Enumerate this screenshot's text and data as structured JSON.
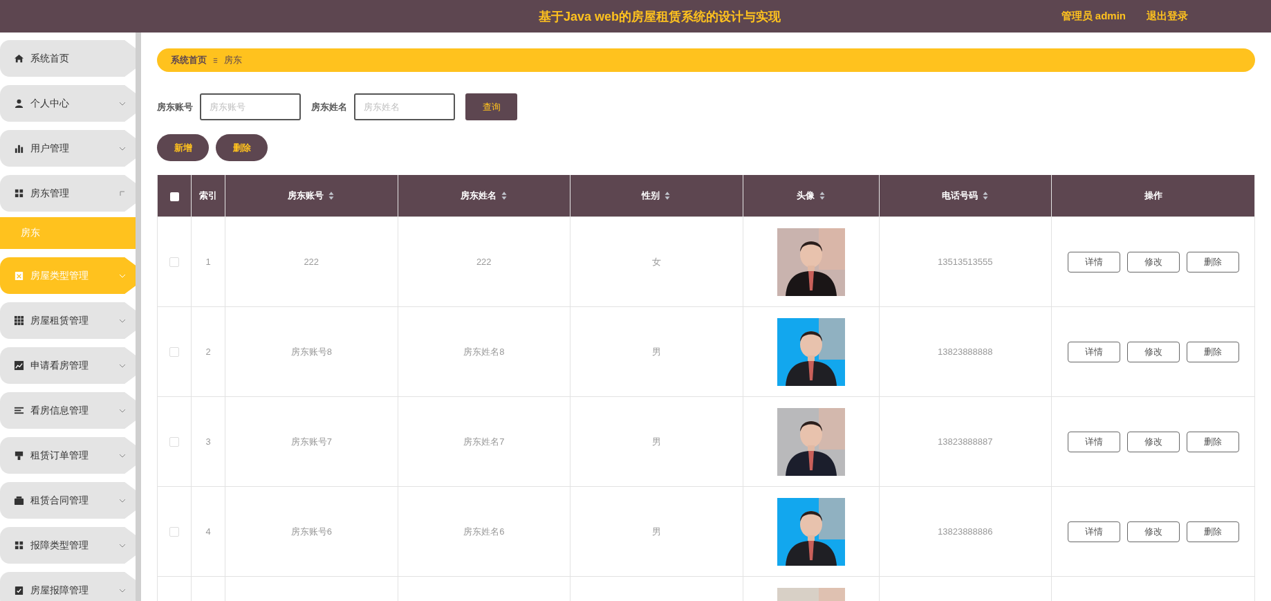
{
  "header": {
    "title": "基于Java web的房屋租赁系统的设计与实现",
    "user": "管理员 admin",
    "logout": "退出登录"
  },
  "sidebar": {
    "items": [
      {
        "label": "系统首页",
        "selected": false
      },
      {
        "label": "个人中心",
        "selected": false,
        "expanded": false
      },
      {
        "label": "用户管理",
        "selected": false,
        "expanded": false
      },
      {
        "label": "房东管理",
        "selected": false,
        "expanded": true,
        "children": [
          {
            "label": "房东",
            "selected": true
          }
        ]
      },
      {
        "label": "房屋类型管理",
        "selected": true,
        "expanded": false
      },
      {
        "label": "房屋租赁管理",
        "selected": false,
        "expanded": false
      },
      {
        "label": "申请看房管理",
        "selected": false,
        "expanded": false
      },
      {
        "label": "看房信息管理",
        "selected": false,
        "expanded": false
      },
      {
        "label": "租赁订单管理",
        "selected": false,
        "expanded": false
      },
      {
        "label": "租赁合同管理",
        "selected": false,
        "expanded": false
      },
      {
        "label": "报障类型管理",
        "selected": false,
        "expanded": false
      },
      {
        "label": "房屋报障管理",
        "selected": false,
        "expanded": false
      }
    ]
  },
  "breadcrumb": [
    "系统首页",
    "房东"
  ],
  "search": {
    "fields": [
      {
        "label": "房东账号",
        "placeholder": "房东账号"
      },
      {
        "label": "房东姓名",
        "placeholder": "房东姓名"
      }
    ],
    "button": "查询"
  },
  "actions": [
    "新增",
    "删除"
  ],
  "table": {
    "select_all": {
      "checked": false
    },
    "columns": [
      {
        "label": "索引",
        "sortable": false
      },
      {
        "label": "房东账号",
        "sortable": true
      },
      {
        "label": "房东姓名",
        "sortable": true
      },
      {
        "label": "性别",
        "sortable": true
      },
      {
        "label": "头像",
        "sortable": true
      },
      {
        "label": "电话号码",
        "sortable": true
      },
      {
        "label": "操作",
        "sortable": false
      }
    ],
    "rows": [
      {
        "checked": false,
        "index": "1",
        "account": "222",
        "name": "222",
        "gender": "女",
        "avatar": {
          "kind": "picture"
        },
        "phone": "13513513555",
        "actions": [
          "详情",
          "修改",
          "删除"
        ]
      },
      {
        "checked": false,
        "index": "2",
        "account": "房东账号8",
        "name": "房东姓名8",
        "gender": "男",
        "avatar": {
          "kind": "picture"
        },
        "phone": "13823888888",
        "actions": [
          "详情",
          "修改",
          "删除"
        ]
      },
      {
        "checked": false,
        "index": "3",
        "account": "房东账号7",
        "name": "房东姓名7",
        "gender": "男",
        "avatar": {
          "kind": "picture"
        },
        "phone": "13823888887",
        "actions": [
          "详情",
          "修改",
          "删除"
        ]
      },
      {
        "checked": false,
        "index": "4",
        "account": "房东账号6",
        "name": "房东姓名6",
        "gender": "男",
        "avatar": {
          "kind": "picture"
        },
        "phone": "13823888886",
        "actions": [
          "详情",
          "修改",
          "删除"
        ]
      },
      {
        "avatar": {
          "kind": "picture"
        }
      }
    ]
  }
}
